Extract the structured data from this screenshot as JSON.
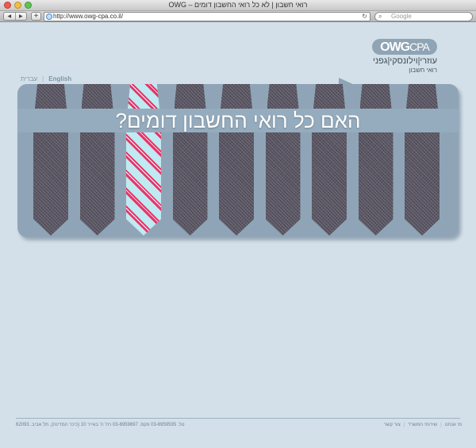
{
  "window": {
    "title": "רואי חשבון | לא כל רואי החשבון דומים – OWG"
  },
  "toolbar": {
    "back_glyph": "◀",
    "forward_glyph": "▶",
    "add_glyph": "+",
    "url": "http://www.owg-cpa.co.il/",
    "reload_glyph": "↻",
    "search_placeholder": "Google",
    "search_glyph": "⌕"
  },
  "language": {
    "hebrew": "עברית",
    "separator": "|",
    "english": "English"
  },
  "logo": {
    "mark_prefix": "OWG",
    "mark_suffix": "CPA",
    "names": "עוזרי|וילונסקי|גפני",
    "subtitle": "רואי חשבון"
  },
  "banner": {
    "headline": "האם כל רואי החשבון דומים?",
    "tie_colors": {
      "gray": "#5a5662",
      "stripe_pink": "#e8346a",
      "stripe_blue": "#bfeaf2"
    },
    "highlighted_tie_index": 2,
    "tie_count": 9
  },
  "footer": {
    "nav": [
      "מי אנחנו",
      "שירותי המשרד",
      "צור קשר"
    ],
    "separator": "|",
    "contact": "טל. 03-6959595  פקס. 03-6959697  רח' ה' באייר 10 (כיכר המדינה), תל אביב. 62093"
  },
  "colors": {
    "page_background": "#d3e0e9",
    "banner": "#8fa5b7",
    "text_muted": "#7e94a6"
  }
}
